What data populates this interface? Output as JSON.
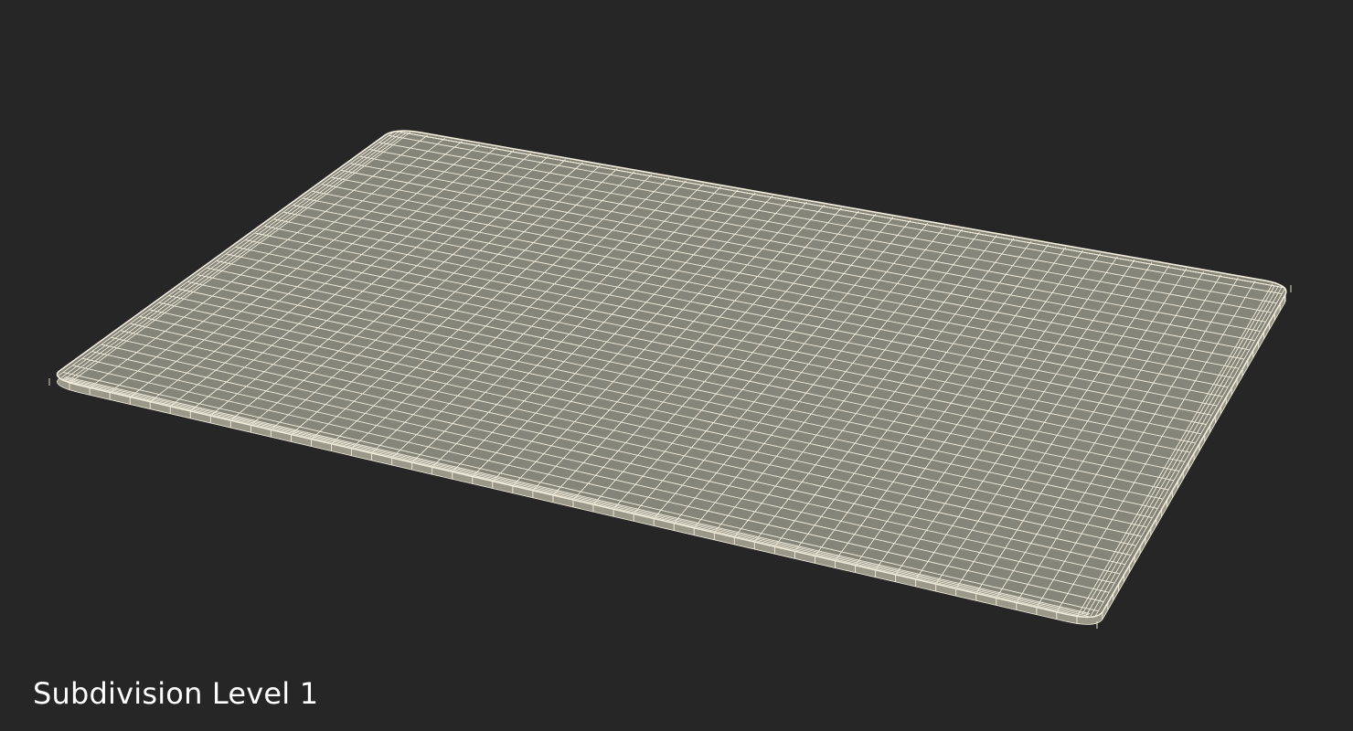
{
  "caption": "Subdivision Level 1",
  "colors": {
    "background": "#262626",
    "surface": "#85857a",
    "wire": "#f3eedd",
    "caption": "#ffffff"
  },
  "mesh": {
    "long_divisions": 52,
    "short_divisions": 36
  }
}
